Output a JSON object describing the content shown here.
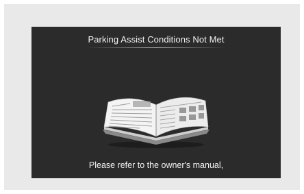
{
  "screen": {
    "title": "Parking Assist Conditions Not Met",
    "message": "Please refer to the owner's manual,",
    "icon": "open-book-icon"
  },
  "colors": {
    "screen_background": "#2b2b2b",
    "frame_background": "#e9e9e9",
    "text": "#f2f2f2"
  }
}
